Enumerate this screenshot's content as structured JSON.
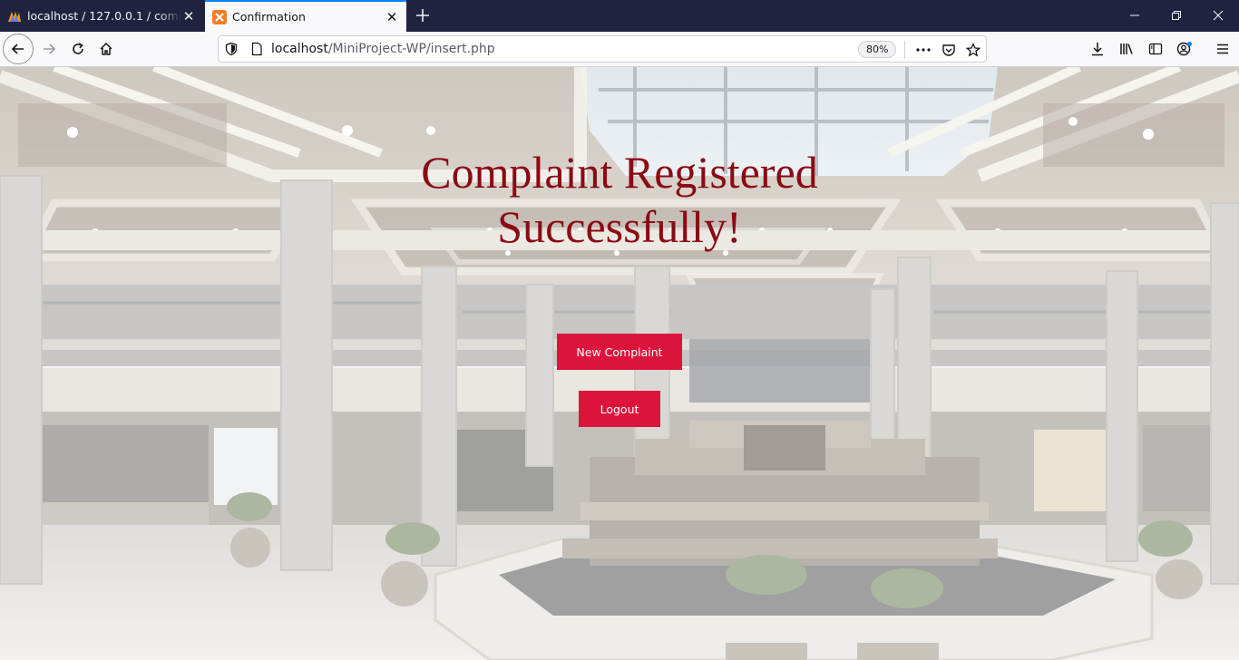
{
  "browser": {
    "tabs": [
      {
        "title": "localhost / 127.0.0.1 / complaints",
        "active": false,
        "icon": "phpmyadmin-icon"
      },
      {
        "title": "Confirmation",
        "active": true,
        "icon": "xampp-icon"
      }
    ],
    "url_host": "localhost",
    "url_path": "/MiniProject-WP/insert.php",
    "zoom": "80%",
    "accent_color": "#0a84ff"
  },
  "page": {
    "headline_line1": "Complaint Registered",
    "headline_line2": "Successfully!",
    "headline_color": "#8b0a14",
    "button_color": "#dc143c",
    "new_complaint_label": "New Complaint",
    "logout_label": "Logout"
  }
}
